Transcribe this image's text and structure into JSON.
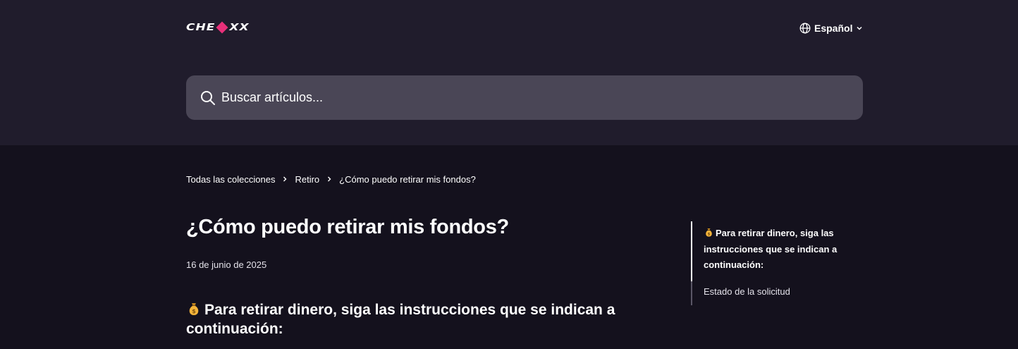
{
  "header": {
    "logo_text_left": "CHE",
    "logo_text_right": "X",
    "language_label": "Español",
    "globe_icon": "globe-icon",
    "chevron_icon": "chevron-down-icon"
  },
  "search": {
    "placeholder": "Buscar artículos...",
    "icon": "search-icon"
  },
  "breadcrumb": {
    "items": [
      "Todas las colecciones",
      "Retiro",
      "¿Cómo puedo retirar mis fondos?"
    ]
  },
  "article": {
    "title": "¿Cómo puedo retirar mis fondos?",
    "date": "16 de junio de 2025",
    "heading_emoji": "money-bag-icon",
    "heading_text": "Para retirar dinero, siga las instrucciones que se indican a continuación:"
  },
  "toc": {
    "items": [
      "Para retirar dinero, siga las instrucciones que se indican a continuación:",
      "Estado de la solicitud"
    ]
  },
  "colors": {
    "page_bg": "#14111d",
    "hero_bg": "#201c2c",
    "search_bg": "#4a4656",
    "brand_accent": "#e8307a"
  }
}
